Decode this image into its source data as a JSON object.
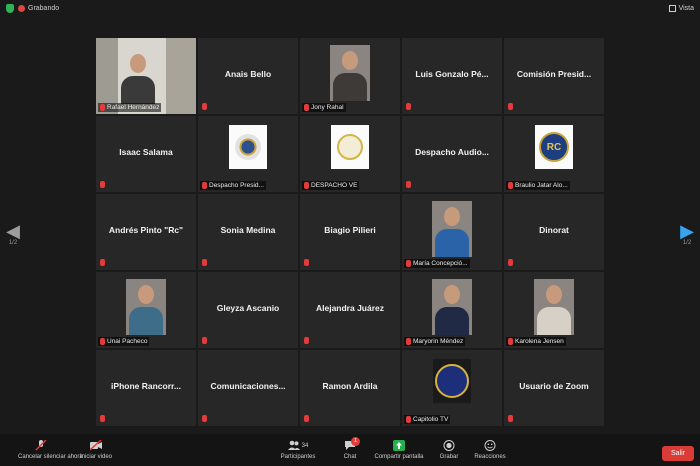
{
  "topbar": {
    "recording_label": "Grabando",
    "view_label": "Vista"
  },
  "nav": {
    "prev_page": "1/2",
    "next_page": "1/2"
  },
  "colors": {
    "active_speaker": "#f0e04e",
    "muted_mic": "#e23b3b",
    "leave": "#d93b36",
    "share": "#22b14c"
  },
  "participants": [
    {
      "name": "Rafael Hernández",
      "kind": "video",
      "active": true
    },
    {
      "display": "Anais Bello",
      "kind": "name"
    },
    {
      "name": "Jony Rahal",
      "kind": "photo",
      "tone": "#3d3a38"
    },
    {
      "display": "Luis Gonzalo Pé...",
      "kind": "name"
    },
    {
      "display": "Comisión Presid...",
      "kind": "name"
    },
    {
      "display": "Isaac Salama",
      "kind": "name"
    },
    {
      "name": "Despacho Presid...",
      "kind": "logo",
      "logo": "seal-blue"
    },
    {
      "name": "DESPACHO VE",
      "kind": "logo",
      "logo": "seal-gold"
    },
    {
      "display": "Despacho Audio...",
      "kind": "name"
    },
    {
      "name": "Braulio Jatar Alo...",
      "kind": "logo",
      "logo": "badge",
      "logo_text": "RC"
    },
    {
      "display": "Andrés Pinto \"Rc\"",
      "kind": "name"
    },
    {
      "display": "Sonia Medina",
      "kind": "name"
    },
    {
      "display": "Biagio Pilieri",
      "kind": "name"
    },
    {
      "name": "María Concepció...",
      "kind": "photo",
      "tone": "#2a63a8"
    },
    {
      "display": "Dinorat",
      "kind": "name"
    },
    {
      "name": "Unai Pacheco",
      "kind": "photo",
      "tone": "#3e6d8a"
    },
    {
      "display": "Gleyza Ascanio",
      "kind": "name"
    },
    {
      "display": "Alejandra Juárez",
      "kind": "name"
    },
    {
      "name": "Maryorin Méndez",
      "kind": "photo",
      "tone": "#202a44"
    },
    {
      "name": "Karolena Jensen",
      "kind": "photo",
      "tone": "#d6d0c6"
    },
    {
      "display": "iPhone Rancorr...",
      "kind": "name"
    },
    {
      "display": "Comunicaciones...",
      "kind": "name"
    },
    {
      "display": "Ramon Ardila",
      "kind": "name"
    },
    {
      "name": "Capitolio TV",
      "kind": "logo",
      "logo": "tv"
    },
    {
      "display": "Usuario de Zoom",
      "kind": "name"
    }
  ],
  "toolbar": {
    "mute_label": "Cancelar silenciar ahora",
    "video_label": "Iniciar video",
    "participants_label": "Participantes",
    "participants_count": "34",
    "chat_label": "Chat",
    "chat_badge": "1",
    "share_label": "Compartir pantalla",
    "record_label": "Grabar",
    "reactions_label": "Reacciones",
    "leave_label": "Salir"
  }
}
